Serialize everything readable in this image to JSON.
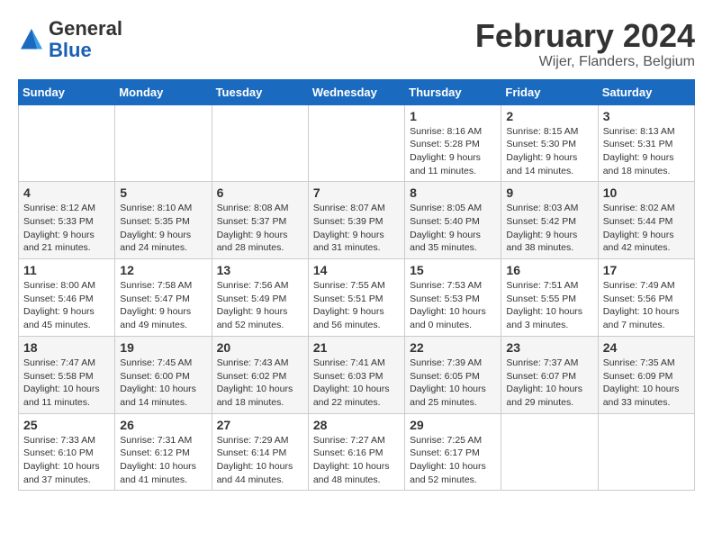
{
  "header": {
    "logo_line1": "General",
    "logo_line2": "Blue",
    "month_title": "February 2024",
    "location": "Wijer, Flanders, Belgium"
  },
  "days_of_week": [
    "Sunday",
    "Monday",
    "Tuesday",
    "Wednesday",
    "Thursday",
    "Friday",
    "Saturday"
  ],
  "weeks": [
    [
      {
        "day": "",
        "info": ""
      },
      {
        "day": "",
        "info": ""
      },
      {
        "day": "",
        "info": ""
      },
      {
        "day": "",
        "info": ""
      },
      {
        "day": "1",
        "info": "Sunrise: 8:16 AM\nSunset: 5:28 PM\nDaylight: 9 hours\nand 11 minutes."
      },
      {
        "day": "2",
        "info": "Sunrise: 8:15 AM\nSunset: 5:30 PM\nDaylight: 9 hours\nand 14 minutes."
      },
      {
        "day": "3",
        "info": "Sunrise: 8:13 AM\nSunset: 5:31 PM\nDaylight: 9 hours\nand 18 minutes."
      }
    ],
    [
      {
        "day": "4",
        "info": "Sunrise: 8:12 AM\nSunset: 5:33 PM\nDaylight: 9 hours\nand 21 minutes."
      },
      {
        "day": "5",
        "info": "Sunrise: 8:10 AM\nSunset: 5:35 PM\nDaylight: 9 hours\nand 24 minutes."
      },
      {
        "day": "6",
        "info": "Sunrise: 8:08 AM\nSunset: 5:37 PM\nDaylight: 9 hours\nand 28 minutes."
      },
      {
        "day": "7",
        "info": "Sunrise: 8:07 AM\nSunset: 5:39 PM\nDaylight: 9 hours\nand 31 minutes."
      },
      {
        "day": "8",
        "info": "Sunrise: 8:05 AM\nSunset: 5:40 PM\nDaylight: 9 hours\nand 35 minutes."
      },
      {
        "day": "9",
        "info": "Sunrise: 8:03 AM\nSunset: 5:42 PM\nDaylight: 9 hours\nand 38 minutes."
      },
      {
        "day": "10",
        "info": "Sunrise: 8:02 AM\nSunset: 5:44 PM\nDaylight: 9 hours\nand 42 minutes."
      }
    ],
    [
      {
        "day": "11",
        "info": "Sunrise: 8:00 AM\nSunset: 5:46 PM\nDaylight: 9 hours\nand 45 minutes."
      },
      {
        "day": "12",
        "info": "Sunrise: 7:58 AM\nSunset: 5:47 PM\nDaylight: 9 hours\nand 49 minutes."
      },
      {
        "day": "13",
        "info": "Sunrise: 7:56 AM\nSunset: 5:49 PM\nDaylight: 9 hours\nand 52 minutes."
      },
      {
        "day": "14",
        "info": "Sunrise: 7:55 AM\nSunset: 5:51 PM\nDaylight: 9 hours\nand 56 minutes."
      },
      {
        "day": "15",
        "info": "Sunrise: 7:53 AM\nSunset: 5:53 PM\nDaylight: 10 hours\nand 0 minutes."
      },
      {
        "day": "16",
        "info": "Sunrise: 7:51 AM\nSunset: 5:55 PM\nDaylight: 10 hours\nand 3 minutes."
      },
      {
        "day": "17",
        "info": "Sunrise: 7:49 AM\nSunset: 5:56 PM\nDaylight: 10 hours\nand 7 minutes."
      }
    ],
    [
      {
        "day": "18",
        "info": "Sunrise: 7:47 AM\nSunset: 5:58 PM\nDaylight: 10 hours\nand 11 minutes."
      },
      {
        "day": "19",
        "info": "Sunrise: 7:45 AM\nSunset: 6:00 PM\nDaylight: 10 hours\nand 14 minutes."
      },
      {
        "day": "20",
        "info": "Sunrise: 7:43 AM\nSunset: 6:02 PM\nDaylight: 10 hours\nand 18 minutes."
      },
      {
        "day": "21",
        "info": "Sunrise: 7:41 AM\nSunset: 6:03 PM\nDaylight: 10 hours\nand 22 minutes."
      },
      {
        "day": "22",
        "info": "Sunrise: 7:39 AM\nSunset: 6:05 PM\nDaylight: 10 hours\nand 25 minutes."
      },
      {
        "day": "23",
        "info": "Sunrise: 7:37 AM\nSunset: 6:07 PM\nDaylight: 10 hours\nand 29 minutes."
      },
      {
        "day": "24",
        "info": "Sunrise: 7:35 AM\nSunset: 6:09 PM\nDaylight: 10 hours\nand 33 minutes."
      }
    ],
    [
      {
        "day": "25",
        "info": "Sunrise: 7:33 AM\nSunset: 6:10 PM\nDaylight: 10 hours\nand 37 minutes."
      },
      {
        "day": "26",
        "info": "Sunrise: 7:31 AM\nSunset: 6:12 PM\nDaylight: 10 hours\nand 41 minutes."
      },
      {
        "day": "27",
        "info": "Sunrise: 7:29 AM\nSunset: 6:14 PM\nDaylight: 10 hours\nand 44 minutes."
      },
      {
        "day": "28",
        "info": "Sunrise: 7:27 AM\nSunset: 6:16 PM\nDaylight: 10 hours\nand 48 minutes."
      },
      {
        "day": "29",
        "info": "Sunrise: 7:25 AM\nSunset: 6:17 PM\nDaylight: 10 hours\nand 52 minutes."
      },
      {
        "day": "",
        "info": ""
      },
      {
        "day": "",
        "info": ""
      }
    ]
  ]
}
